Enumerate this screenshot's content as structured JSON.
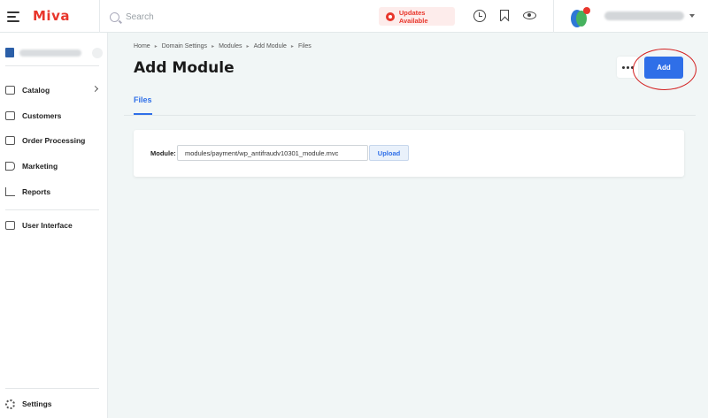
{
  "app": {
    "logo": "Miva"
  },
  "header": {
    "search_placeholder": "Search",
    "updates_label": "Updates Available",
    "user_name": "",
    "icons": [
      "menu-icon",
      "search-icon",
      "history-icon",
      "bookmark-icon",
      "eye-icon",
      "chevron-down-icon"
    ]
  },
  "sidebar": {
    "store_name": "",
    "items": [
      {
        "label": "Catalog",
        "icon": "catalog-icon"
      },
      {
        "label": "Customers",
        "icon": "customers-icon"
      },
      {
        "label": "Order Processing",
        "icon": "orders-icon"
      },
      {
        "label": "Marketing",
        "icon": "megaphone-icon"
      },
      {
        "label": "Reports",
        "icon": "bar-chart-icon"
      },
      {
        "label": "User Interface",
        "icon": "window-icon"
      }
    ],
    "settings_label": "Settings"
  },
  "breadcrumb": [
    "Home",
    "Domain Settings",
    "Modules",
    "Add Module",
    "Files"
  ],
  "page": {
    "title": "Add Module",
    "add_label": "Add",
    "tab_label": "Files"
  },
  "form": {
    "module_label": "Module:",
    "module_value": "modules/payment/wp_antifraudv10301_module.mvc",
    "upload_label": "Upload"
  },
  "colors": {
    "brand": "#e8362c",
    "accent": "#2f6fe8",
    "highlight": "#d31f1f"
  }
}
